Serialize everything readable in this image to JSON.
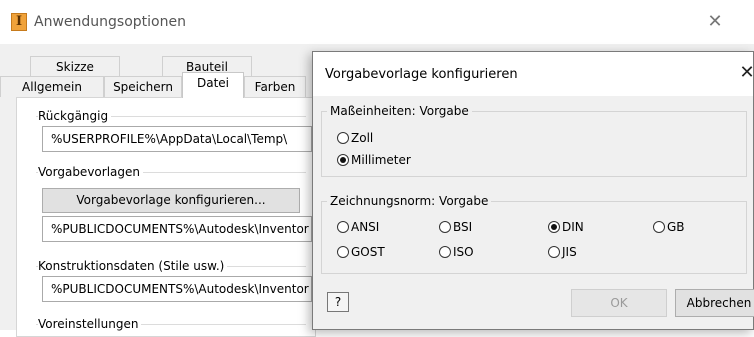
{
  "window": {
    "title": "Anwendungsoptionen",
    "close_symbol": "✕",
    "app_icon_letter": "I"
  },
  "tabs": {
    "row1": [
      "Skizze",
      "Bauteil"
    ],
    "row2": [
      "Allgemein",
      "Speichern",
      "Datei",
      "Farben"
    ],
    "active": "Datei"
  },
  "datei": {
    "undo": {
      "label": "Rückgängig",
      "path": "%USERPROFILE%\\AppData\\Local\\Temp\\"
    },
    "templates": {
      "label": "Vorgabevorlagen",
      "button": "Vorgabevorlage konfigurieren...",
      "path": "%PUBLICDOCUMENTS%\\Autodesk\\Inventor %"
    },
    "design_data": {
      "label": "Konstruktionsdaten (Stile usw.)",
      "path": "%PUBLICDOCUMENTS%\\Autodesk\\Inventor %"
    },
    "defaults": {
      "label": "Voreinstellungen"
    }
  },
  "dialog": {
    "title": "Vorgabevorlage konfigurieren",
    "close_symbol": "✕",
    "units": {
      "legend": "Maßeinheiten: Vorgabe",
      "options": [
        {
          "label": "Zoll",
          "selected": false
        },
        {
          "label": "Millimeter",
          "selected": true
        }
      ]
    },
    "standard": {
      "legend": "Zeichnungsnorm: Vorgabe",
      "options": [
        {
          "label": "ANSI",
          "selected": false
        },
        {
          "label": "BSI",
          "selected": false
        },
        {
          "label": "DIN",
          "selected": true
        },
        {
          "label": "GB",
          "selected": false
        },
        {
          "label": "GOST",
          "selected": false
        },
        {
          "label": "ISO",
          "selected": false
        },
        {
          "label": "JIS",
          "selected": false
        }
      ]
    },
    "help_symbol": "?",
    "ok_label": "OK",
    "cancel_label": "Abbrechen"
  }
}
